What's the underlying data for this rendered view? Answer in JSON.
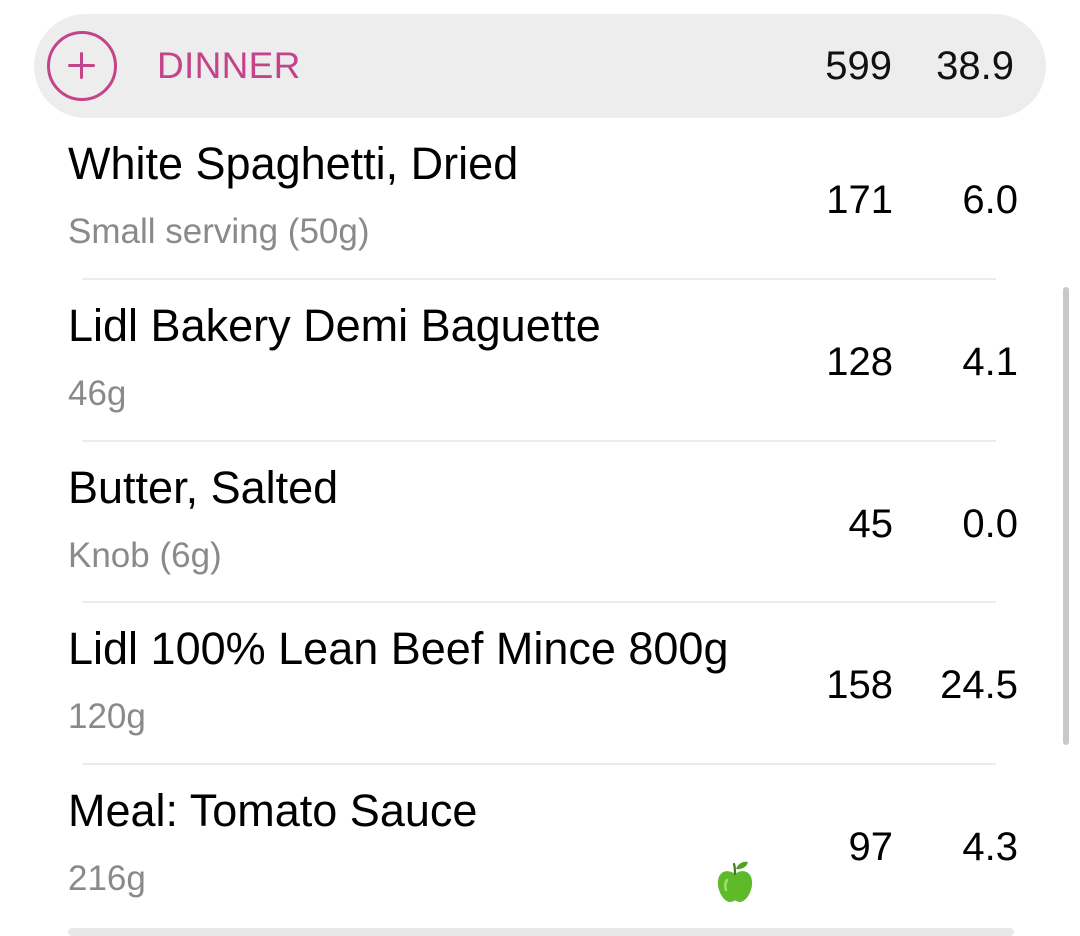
{
  "meal": {
    "title": "DINNER",
    "total_calories": "599",
    "total_protein": "38.9"
  },
  "items": [
    {
      "name": "White Spaghetti, Dried",
      "serving": "Small serving (50g)",
      "calories": "171",
      "protein": "6.0"
    },
    {
      "name": "Lidl Bakery Demi Baguette",
      "serving": "46g",
      "calories": "128",
      "protein": "4.1"
    },
    {
      "name": "Butter, Salted",
      "serving": "Knob (6g)",
      "calories": "45",
      "protein": "0.0"
    },
    {
      "name": "Lidl 100% Lean Beef Mince 800g",
      "serving": "120g",
      "calories": "158",
      "protein": "24.5"
    },
    {
      "name": "Meal: Tomato Sauce",
      "serving": "216g",
      "calories": "97",
      "protein": "4.3",
      "icon": "green-apple-icon"
    }
  ],
  "colors": {
    "accent": "#c4448a",
    "header_bg": "#ededed",
    "secondary_text": "#8a8a8a",
    "apple_green": "#5fba2a"
  }
}
